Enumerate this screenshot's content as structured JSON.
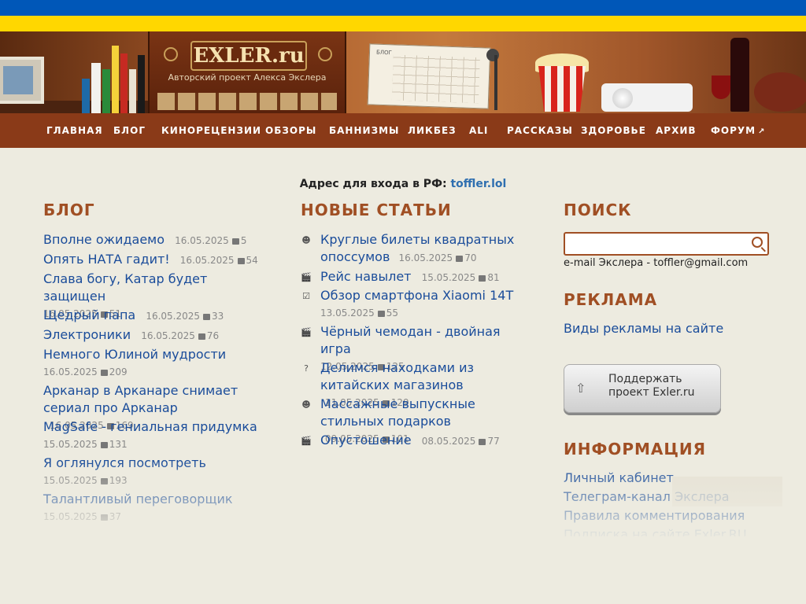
{
  "header": {
    "logo_text": "EXLER.ru",
    "logo_subtitle": "Авторский проект Алекса Экслера",
    "calendar_label": "БЛОГ"
  },
  "nav": {
    "items": [
      "ГЛАВНАЯ",
      "БЛОГ",
      "КИНОРЕЦЕНЗИИ",
      "ОБЗОРЫ",
      "БАННИЗМЫ",
      "ЛИКБЕЗ",
      "ALI",
      "РАССКАЗЫ",
      "ЗДОРОВЬЕ",
      "АРХИВ",
      "ФОРУМ"
    ]
  },
  "entry": {
    "label": "Адрес для входа в РФ:",
    "link": "toffler.lol"
  },
  "blog": {
    "title": "БЛОГ",
    "items": [
      {
        "title": "Вполне ожидаемо",
        "date": "16.05.2025",
        "comments": "5"
      },
      {
        "title": "Опять НАТА гадит!",
        "date": "16.05.2025",
        "comments": "54"
      },
      {
        "title": "Слава богу, Катар будет защищен",
        "date": "16.05.2025",
        "comments": "51"
      },
      {
        "title": "Щедрый папа",
        "date": "16.05.2025",
        "comments": "33"
      },
      {
        "title": "Электроники",
        "date": "16.05.2025",
        "comments": "76"
      },
      {
        "title": "Немного Юлиной мудрости",
        "date": "16.05.2025",
        "comments": "209"
      },
      {
        "title": "Арканар в Арканаре снимает сериал про Арканар",
        "date": "16.05.2025",
        "comments": "169"
      },
      {
        "title": "MagSafe - гениальная придумка",
        "date": "15.05.2025",
        "comments": "131"
      },
      {
        "title": "Я оглянулся посмотреть",
        "date": "15.05.2025",
        "comments": "193"
      },
      {
        "title": "Талантливый переговорщик",
        "date": "15.05.2025",
        "comments": "37"
      }
    ]
  },
  "articles": {
    "title": "НОВЫЕ СТАТЬИ",
    "items": [
      {
        "icon": "smiley-icon",
        "title": "Круглые билеты квадратных опоссумов",
        "date": "16.05.2025",
        "comments": "70"
      },
      {
        "icon": "clapper-icon",
        "title": "Рейс навылет",
        "date": "15.05.2025",
        "comments": "81"
      },
      {
        "icon": "checklist-icon",
        "title": "Обзор смартфона Xiaomi 14T",
        "date": "13.05.2025",
        "comments": "55"
      },
      {
        "icon": "clapper-icon",
        "title": "Чёрный чемодан - двойная игра",
        "date": "12.05.2025",
        "comments": "125"
      },
      {
        "icon": "question-icon",
        "title": "Делимся находками из китайских магазинов",
        "date": "11.05.2025",
        "comments": "129"
      },
      {
        "icon": "smiley-icon",
        "title": "Массажные выпускные стильных подарков",
        "date": "09.05.2025",
        "comments": "101"
      },
      {
        "icon": "clapper-icon",
        "title": "Опустошение",
        "date": "08.05.2025",
        "comments": "77"
      }
    ]
  },
  "sidebar": {
    "search_title": "ПОИСК",
    "search_placeholder": "",
    "email_text": "e-mail Экслера - toffler@gmail.com",
    "ads_title": "РЕКЛАМА",
    "ads_link": "Виды рекламы на сайте",
    "support_label": "Поддержать проект Exler.ru",
    "info_title": "ИНФОРМАЦИЯ",
    "info_links": [
      "Личный кабинет",
      "Телеграм-канал Экслера",
      "Правила комментирования",
      "Подписка на сайте Exler.RU"
    ]
  },
  "colors": {
    "accent": "#a04f24",
    "nav_bg": "#8a3a18",
    "link": "#1a4c9a",
    "page_bg": "#edebe0",
    "flag_blue": "#0057b8",
    "flag_yellow": "#ffd700"
  }
}
